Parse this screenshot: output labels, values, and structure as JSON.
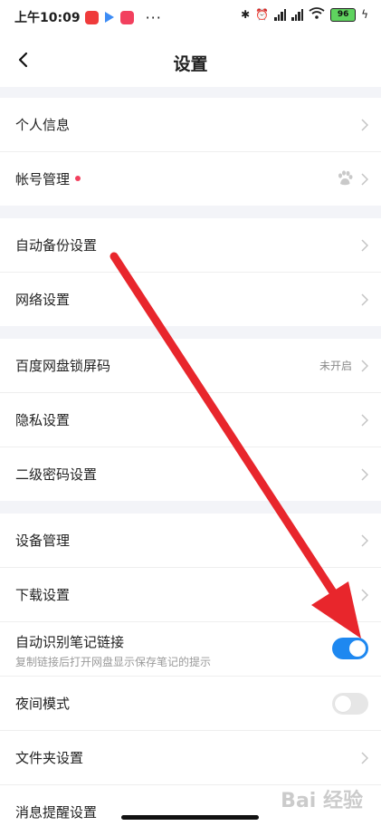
{
  "status_bar": {
    "time": "上午10:09",
    "dots": "···",
    "battery": "96"
  },
  "header": {
    "title": "设置"
  },
  "rows": [
    {
      "label": "个人信息"
    },
    {
      "label": "帐号管理"
    },
    {
      "label": "自动备份设置"
    },
    {
      "label": "网络设置"
    },
    {
      "label": "百度网盘锁屏码",
      "value": "未开启"
    },
    {
      "label": "隐私设置"
    },
    {
      "label": "二级密码设置"
    },
    {
      "label": "设备管理"
    },
    {
      "label": "下载设置"
    },
    {
      "label": "自动识别笔记链接",
      "sublabel": "复制链接后打开网盘显示保存笔记的提示",
      "toggle_on": true
    },
    {
      "label": "夜间模式",
      "toggle_on": false
    },
    {
      "label": "文件夹设置"
    },
    {
      "label": "消息提醒设置"
    }
  ],
  "watermark": "Bai 经验",
  "colors": {
    "accent": "#1e88f0",
    "arrow": "#e8262c",
    "section_gap": "#f3f4f8"
  }
}
